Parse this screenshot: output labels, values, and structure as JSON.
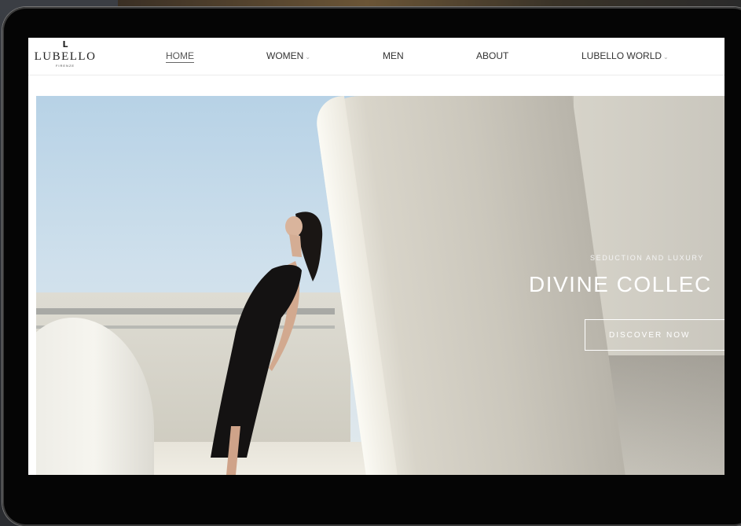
{
  "brand": {
    "mark": "L",
    "name": "LUBELLO",
    "sub": "FIRENZE"
  },
  "nav": {
    "items": [
      {
        "label": "HOME",
        "active": true,
        "has_dropdown": false
      },
      {
        "label": "WOMEN",
        "active": false,
        "has_dropdown": true
      },
      {
        "label": "MEN",
        "active": false,
        "has_dropdown": false
      },
      {
        "label": "ABOUT",
        "active": false,
        "has_dropdown": false
      },
      {
        "label": "LUBELLO WORLD",
        "active": false,
        "has_dropdown": true
      }
    ],
    "chevron": "⌄"
  },
  "hero": {
    "tagline": "SEDUCTION AND LUXURY",
    "title": "DIVINE COLLEC",
    "cta_label": "DISCOVER NOW"
  },
  "colors": {
    "bezel": "#050505",
    "sky": "#b7d2e6",
    "concrete": "#c9c6bc",
    "text_on_hero": "#ffffff"
  }
}
